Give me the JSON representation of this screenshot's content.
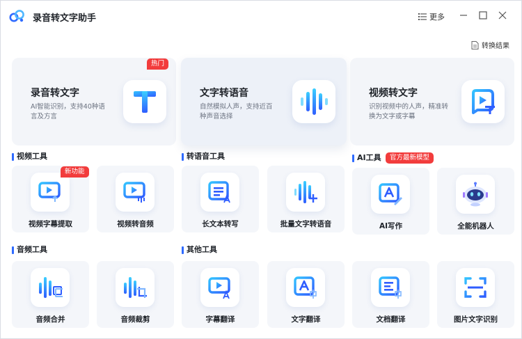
{
  "app": {
    "title": "录音转文字助手"
  },
  "titlebar": {
    "more_label": "更多"
  },
  "results": {
    "label": "转换结果"
  },
  "hero": [
    {
      "title": "录音转文字",
      "desc": "AI智能识别，支持40种语言及方言",
      "badge": "热门",
      "icon": "letter-t-icon"
    },
    {
      "title": "文字转语音",
      "desc": "自然模拟人声，支持近百种声音选择",
      "icon": "waveform-icon"
    },
    {
      "title": "视频转文字",
      "desc": "识别视频中的人声，精准转换为文字或字幕",
      "icon": "video-to-text-icon"
    }
  ],
  "sections": {
    "video": {
      "title": "视频工具"
    },
    "transvoice": {
      "title": "转语音工具"
    },
    "ai": {
      "title": "AI工具",
      "badge": "官方最新模型"
    },
    "audio": {
      "title": "音频工具"
    },
    "other": {
      "title": "其他工具"
    }
  },
  "tiles": {
    "video_subtitle_extract": {
      "label": "视频字幕提取",
      "badge": "新功能"
    },
    "video_to_audio": {
      "label": "视频转音频"
    },
    "long_text_to_speech": {
      "label": "长文本转写"
    },
    "batch_text_to_speech": {
      "label": "批量文字转语音"
    },
    "ai_writing": {
      "label": "AI写作"
    },
    "robot": {
      "label": "全能机器人"
    },
    "audio_merge": {
      "label": "音频合并"
    },
    "audio_cut": {
      "label": "音频裁剪"
    },
    "subtitle_translate": {
      "label": "字幕翻译"
    },
    "text_translate": {
      "label": "文字翻译"
    },
    "doc_translate": {
      "label": "文档翻译"
    },
    "image_ocr": {
      "label": "图片文字识别"
    }
  },
  "colors": {
    "accent": "#2f6bff",
    "accent_light": "#4fb7ff",
    "badge": "#f23c3c"
  }
}
